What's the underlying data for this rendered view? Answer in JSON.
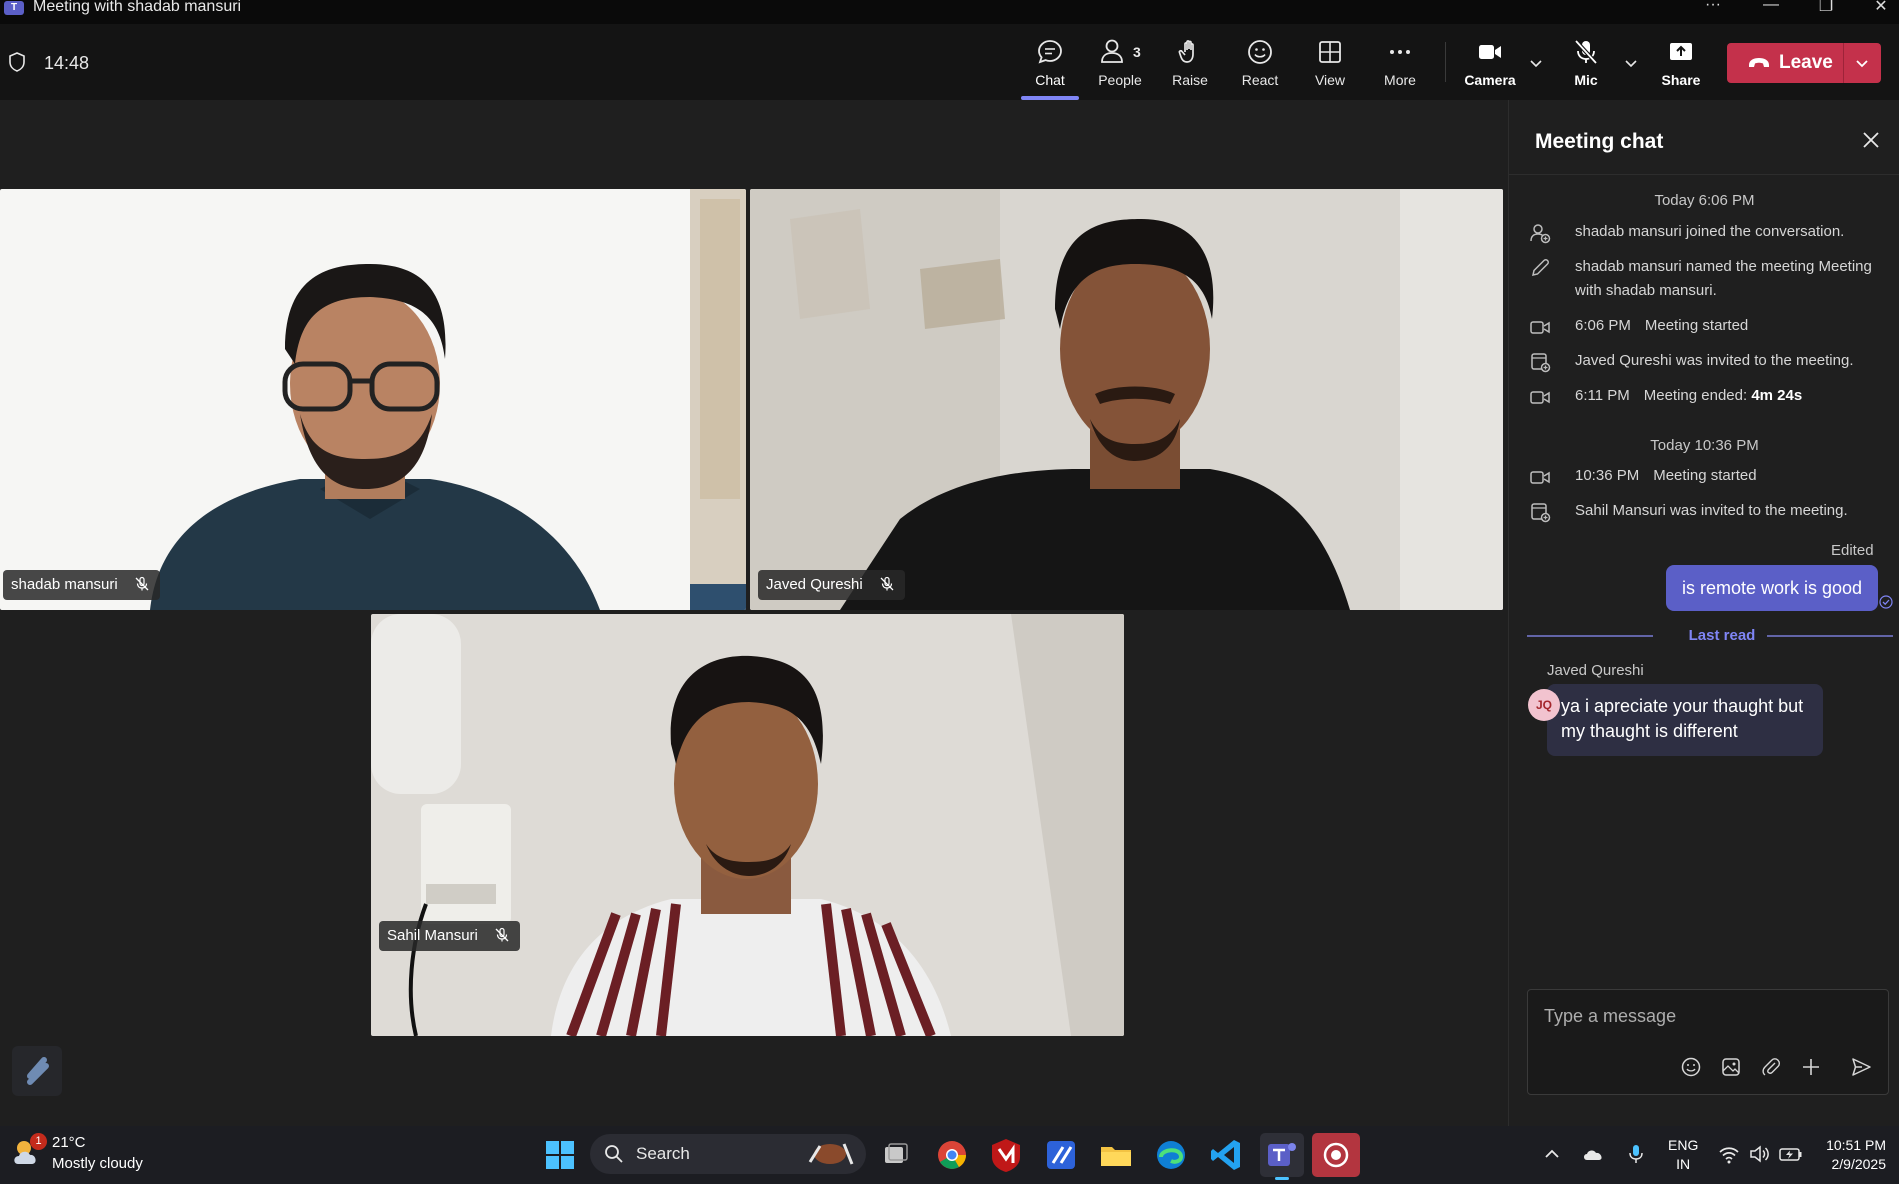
{
  "window": {
    "title": "Meeting with shadab mansuri"
  },
  "toolbar": {
    "timer": "14:48",
    "chat_label": "Chat",
    "people_label": "People",
    "people_count": "3",
    "raise_label": "Raise",
    "react_label": "React",
    "view_label": "View",
    "more_label": "More",
    "camera_label": "Camera",
    "mic_label": "Mic",
    "share_label": "Share",
    "leave_label": "Leave"
  },
  "participants": [
    {
      "name": "shadab mansuri"
    },
    {
      "name": "Javed Qureshi"
    },
    {
      "name": "Sahil Mansuri"
    }
  ],
  "chat": {
    "title": "Meeting chat",
    "date1": "Today 6:06 PM",
    "events1": [
      {
        "text": "shadab mansuri joined the conversation.",
        "icon": "person-add-icon"
      },
      {
        "text": "shadab mansuri named the meeting Meeting with shadab mansuri.",
        "icon": "pencil-icon"
      },
      {
        "time": "6:06 PM",
        "text": "Meeting started",
        "icon": "video-icon"
      },
      {
        "text": "Javed Qureshi was invited to the meeting.",
        "icon": "calendar-add-icon"
      },
      {
        "time": "6:11 PM",
        "text": "Meeting ended: ",
        "bold": "4m 24s",
        "icon": "video-icon"
      }
    ],
    "date2": "Today 10:36 PM",
    "events2": [
      {
        "time": "10:36 PM",
        "text": "Meeting started",
        "icon": "video-icon"
      },
      {
        "text": "Sahil Mansuri was invited to the meeting.",
        "icon": "calendar-add-icon"
      }
    ],
    "edited_label": "Edited",
    "my_message": "is remote work is good",
    "last_read_label": "Last read",
    "sender_name": "Javed Qureshi",
    "sender_initials": "JQ",
    "their_message": "ya i apreciate your thaught but my thaught is different",
    "composer_placeholder": "Type a message"
  },
  "taskbar": {
    "badge": "1",
    "temperature": "21°C",
    "condition": "Mostly cloudy",
    "search_label": "Search",
    "lang_line1": "ENG",
    "lang_line2": "IN",
    "time": "10:51 PM",
    "date": "2/9/2025"
  },
  "colors": {
    "accent": "#5b5fc7",
    "leave": "#c4314b",
    "bubble_mine": "#5b5fc7",
    "bubble_theirs": "#2e2f43"
  }
}
